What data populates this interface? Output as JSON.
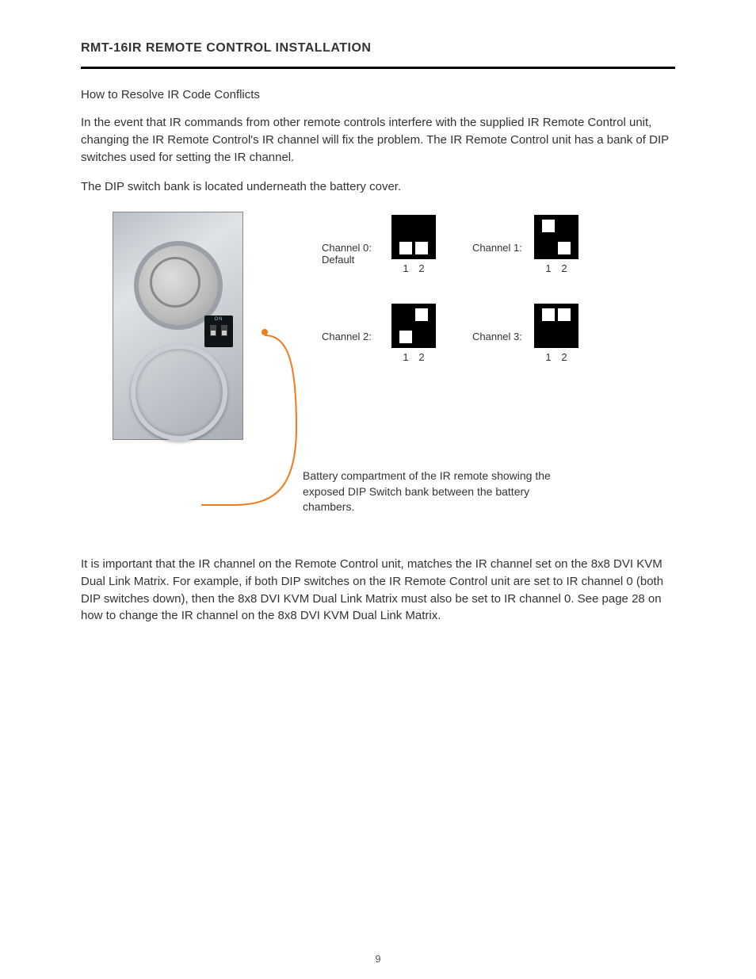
{
  "header_title": "RMT-16IR REMOTE CONTROL INSTALLATION",
  "subheader": "How to Resolve IR Code Conflicts",
  "para1": "In the event that IR commands from other remote controls interfere with the supplied IR Remote Control unit, changing the IR Remote Control's IR channel will fix the problem.  The IR Remote Control unit has a bank of DIP switches used for setting the IR channel.",
  "para2": "The DIP switch bank is located underneath the battery cover.",
  "photo_on_label": "ON",
  "channels": {
    "c0": "Channel 0:\nDefault",
    "c1": "Channel 1:",
    "c2": "Channel 2:",
    "c3": "Channel 3:"
  },
  "dip_numbers": {
    "n1": "1",
    "n2": "2"
  },
  "caption": "Battery compartment of the IR remote showing the exposed DIP Switch bank between the battery chambers.",
  "para3": "It is important that the IR channel on the Remote Control unit, matches the IR channel set on the 8x8 DVI KVM Dual Link Matrix.  For example, if both DIP switches on the IR Remote Control unit are set to IR channel 0 (both DIP switches down), then the 8x8 DVI KVM Dual Link Matrix must also be set to IR channel 0.  See page 28 on how to change the IR channel on the 8x8 DVI KVM Dual Link Matrix.",
  "page_number": "9"
}
